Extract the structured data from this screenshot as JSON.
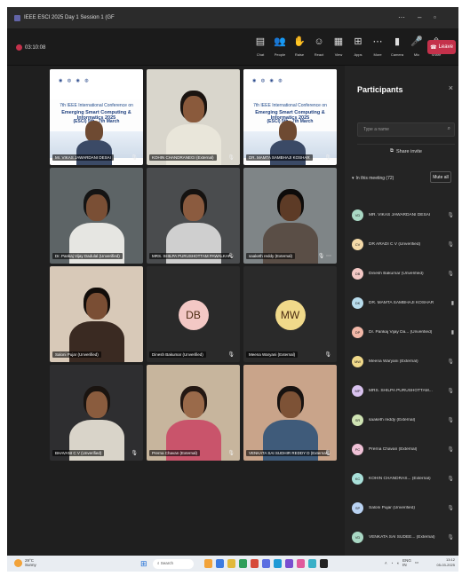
{
  "window": {
    "title": "IEEE ESCI 2025 Day 1 Session 1 (GF"
  },
  "toolbar": {
    "timer": "03:10:08",
    "buttons": [
      {
        "name": "chat",
        "icon": "▤",
        "label": "Chat"
      },
      {
        "name": "people",
        "icon": "👥",
        "label": "People"
      },
      {
        "name": "raise",
        "icon": "✋",
        "label": "Raise"
      },
      {
        "name": "react",
        "icon": "☺",
        "label": "React"
      },
      {
        "name": "view",
        "icon": "▦",
        "label": "View"
      },
      {
        "name": "apps",
        "icon": "⊞",
        "label": "Apps"
      },
      {
        "name": "more",
        "icon": "⋯",
        "label": "More"
      },
      {
        "name": "camera",
        "icon": "▮",
        "label": "Camera"
      },
      {
        "name": "mic",
        "icon": "🎤",
        "label": "Mic"
      },
      {
        "name": "share",
        "icon": "⇧",
        "label": "Share"
      }
    ],
    "leave_label": "Leave"
  },
  "tiles": [
    {
      "kind": "slide",
      "name": "Mr. VIKAS JAWARDANI DESAI",
      "mic": "🎙",
      "slide_line1": "7th IEEE International Conference on",
      "slide_line2": "Emerging Smart Computing & Informatics 2025",
      "slide_line3": "(ESCI) 5th - 7th March"
    },
    {
      "kind": "camera",
      "name": "KOHIN CHANDRANEGI (External)",
      "mic": "🎙",
      "bg": "#d9d6cc",
      "skin": "#8a5a3c",
      "shirt": "#e9e6da",
      "hair": "#1a1410"
    },
    {
      "kind": "slide",
      "name": "DR. MAMTA SAMBHAJI KOSHAR",
      "mic": "🎙",
      "slide_line1": "7th IEEE International Conference on",
      "slide_line2": "Emerging Smart Computing & Informatics 2025",
      "slide_line3": "(ESCI) 5th - 7th March"
    },
    {
      "kind": "camera",
      "name": "Dr. Pankaj Vijay Dadulal (Unverified)",
      "mic": "",
      "bg": "#5d6466",
      "skin": "#7a4f35",
      "shirt": "#e6e6e2",
      "hair": "#141414"
    },
    {
      "kind": "camera",
      "name": "MRS. SHILPA PURUSHOTTAM PAWALKAR",
      "mic": "🎙",
      "bg": "#4a4c4e",
      "skin": "#8b5b3f",
      "shirt": "#cfcfcf",
      "hair": "#151210"
    },
    {
      "kind": "camera",
      "name": "saaketh reddy (External)",
      "mic": "🎙 ⋯",
      "bg": "#7f8587",
      "skin": "#5d3b26",
      "shirt": "#5a4e46",
      "hair": "#0d0b0a"
    },
    {
      "kind": "camera",
      "name": "Saloni Pujar (Unverified)",
      "mic": "",
      "bg": "#d8c9b8",
      "skin": "#7a4e34",
      "shirt": "#3a2a22",
      "hair": "#120d0a"
    },
    {
      "kind": "avatar",
      "name": "Dinesh Bakumar (Unverified)",
      "mic": "🎙",
      "bg": "#2a2a2a",
      "initials": "DB",
      "avatar_color": "#f3c8c5"
    },
    {
      "kind": "avatar",
      "name": "Meena Waryani (External)",
      "mic": "🎙",
      "bg": "#2a2a2a",
      "initials": "MW",
      "avatar_color": "#f0d98a"
    },
    {
      "kind": "camera",
      "name": "BHAVANI C V (Unverified)",
      "mic": "🎙",
      "bg": "#2e2e30",
      "skin": "#8a5c3e",
      "shirt": "#d9d4c9",
      "hair": "#1a1410"
    },
    {
      "kind": "camera",
      "name": "Prerna Chavan (External)",
      "mic": "🎙",
      "bg": "#c7b59d",
      "skin": "#9a6a4a",
      "shirt": "#c9546b",
      "hair": "#231712"
    },
    {
      "kind": "camera",
      "name": "VENKATA SAI SUDHIR REDDY D (External)",
      "mic": "🎙",
      "bg": "#c9a48a",
      "skin": "#7d5236",
      "shirt": "#3f5b7a",
      "hair": "#171210"
    }
  ],
  "participants_panel": {
    "title": "Participants",
    "close_icon": "×",
    "search_placeholder": "Type a name",
    "share_invite": "Share invite",
    "in_meeting_label": "In this meeting (72)",
    "mute_all": "Mute all",
    "people": [
      {
        "initials": "VD",
        "name": "MR. VIKAS JAWARDANI DESAI",
        "mic": "🎙",
        "color": "#a9d8c4"
      },
      {
        "initials": "CV",
        "name": "DR ARADI C V (Unverified)",
        "mic": "🎙",
        "color": "#f3d9a8"
      },
      {
        "initials": "DB",
        "name": "Dinesh Bakumar (Unverified)",
        "mic": "🎙",
        "color": "#f3c8c5"
      },
      {
        "initials": "DK",
        "name": "DR. MAMTA SAMBHAJI KOSHAR",
        "mic": "▮",
        "color": "#b8dcec"
      },
      {
        "initials": "DP",
        "name": "Dr. Pankaj Vijay Da... (Unverified)",
        "mic": "▮",
        "color": "#f2b8a8"
      },
      {
        "initials": "MW",
        "name": "Meena Waryani (External)",
        "mic": "🎙",
        "color": "#f0d98a"
      },
      {
        "initials": "MP",
        "name": "MRS. SHILPA PURUSHOTTAM...",
        "mic": "🎙",
        "color": "#d9c2ee"
      },
      {
        "initials": "SR",
        "name": "saaketh reddy (External)",
        "mic": "🎙",
        "color": "#cfe3b3"
      },
      {
        "initials": "PC",
        "name": "Prerna Chavan (External)",
        "mic": "🎙",
        "color": "#efc1d6"
      },
      {
        "initials": "KC",
        "name": "KOHIN CHANDRAS... (External)",
        "mic": "🎙",
        "color": "#a9e0d9"
      },
      {
        "initials": "SP",
        "name": "Saloni Pujar (Unverified)",
        "mic": "🎙",
        "color": "#b9d2f2"
      },
      {
        "initials": "VD",
        "name": "VENKATA SAI SUDEE... (External)",
        "mic": "🎙",
        "color": "#a9d8c4"
      }
    ]
  },
  "taskbar": {
    "weather_temp": "29°C",
    "weather_desc": "Sunny",
    "search_label": "Search",
    "tray_lang": "ENG",
    "tray_region": "IN",
    "time": "13:12",
    "date": "05-03-2025",
    "app_colors": [
      "#f2a33a",
      "#3d7be0",
      "#e2b93b",
      "#2f9e5a",
      "#d64a3a",
      "#5b6ee1",
      "#1f9ad6",
      "#7a4fd0",
      "#e05a9c",
      "#3ab0c7",
      "#222222"
    ]
  }
}
